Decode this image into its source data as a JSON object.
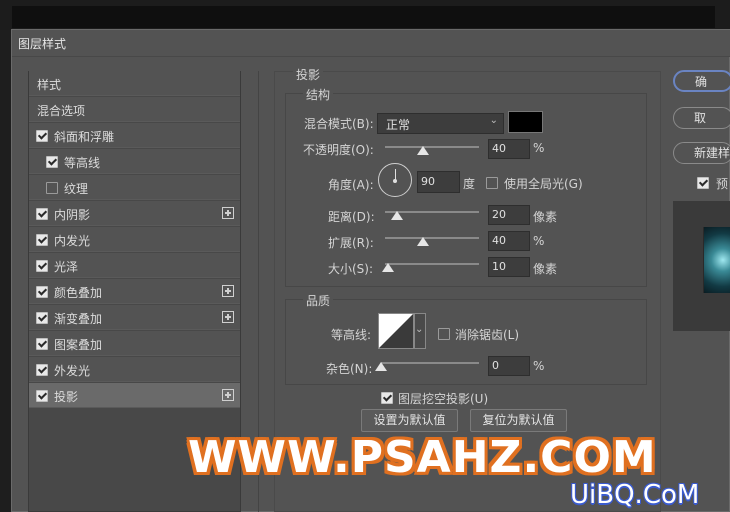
{
  "window": {
    "title": "图层样式"
  },
  "sidebar": {
    "items": [
      {
        "label": "样式",
        "checkbox": null,
        "plus": false
      },
      {
        "label": "混合选项",
        "checkbox": null,
        "plus": false
      },
      {
        "label": "斜面和浮雕",
        "checkbox": true,
        "plus": false
      },
      {
        "label": "等高线",
        "checkbox": true,
        "plus": false
      },
      {
        "label": "纹理",
        "checkbox": false,
        "plus": false
      },
      {
        "label": "内阴影",
        "checkbox": true,
        "plus": true
      },
      {
        "label": "内发光",
        "checkbox": true,
        "plus": false
      },
      {
        "label": "光泽",
        "checkbox": true,
        "plus": false
      },
      {
        "label": "颜色叠加",
        "checkbox": true,
        "plus": true
      },
      {
        "label": "渐变叠加",
        "checkbox": true,
        "plus": true
      },
      {
        "label": "图案叠加",
        "checkbox": true,
        "plus": false
      },
      {
        "label": "外发光",
        "checkbox": true,
        "plus": false
      },
      {
        "label": "投影",
        "checkbox": true,
        "plus": true,
        "selected": true
      }
    ]
  },
  "main": {
    "section_title": "投影",
    "structure": {
      "title": "结构",
      "blend_mode_label": "混合模式(B):",
      "blend_mode_value": "正常",
      "shadow_color": "#000000",
      "opacity_label": "不透明度(O):",
      "opacity_value": "40",
      "opacity_unit": "%",
      "opacity_fraction": 0.4,
      "angle_label": "角度(A):",
      "angle_value": "90",
      "angle_unit": "度",
      "global_light_label": "使用全局光(G)",
      "global_light_checked": false,
      "distance_label": "距离(D):",
      "distance_value": "20",
      "distance_unit": "像素",
      "distance_fraction": 0.13,
      "spread_label": "扩展(R):",
      "spread_value": "40",
      "spread_unit": "%",
      "spread_fraction": 0.4,
      "size_label": "大小(S):",
      "size_value": "10",
      "size_unit": "像素",
      "size_fraction": 0.03
    },
    "quality": {
      "title": "品质",
      "contour_label": "等高线:",
      "antialias_label": "消除锯齿(L)",
      "antialias_checked": false,
      "noise_label": "杂色(N):",
      "noise_value": "0",
      "noise_unit": "%",
      "noise_fraction": 0
    },
    "knockout_label": "图层挖空投影(U)",
    "knockout_checked": true,
    "set_default_label": "设置为默认值",
    "reset_default_label": "复位为默认值"
  },
  "right": {
    "ok_label": "确",
    "cancel_label": "取",
    "new_style_label": "新建样",
    "preview_label": "预",
    "preview_checked": true
  },
  "watermark": {
    "main": "WWW.PSAHZ.COM",
    "corner": "UiBQ.CoM",
    "main_stroke_color": "#e07020",
    "corner_stroke_color": "#3a5bd0"
  }
}
